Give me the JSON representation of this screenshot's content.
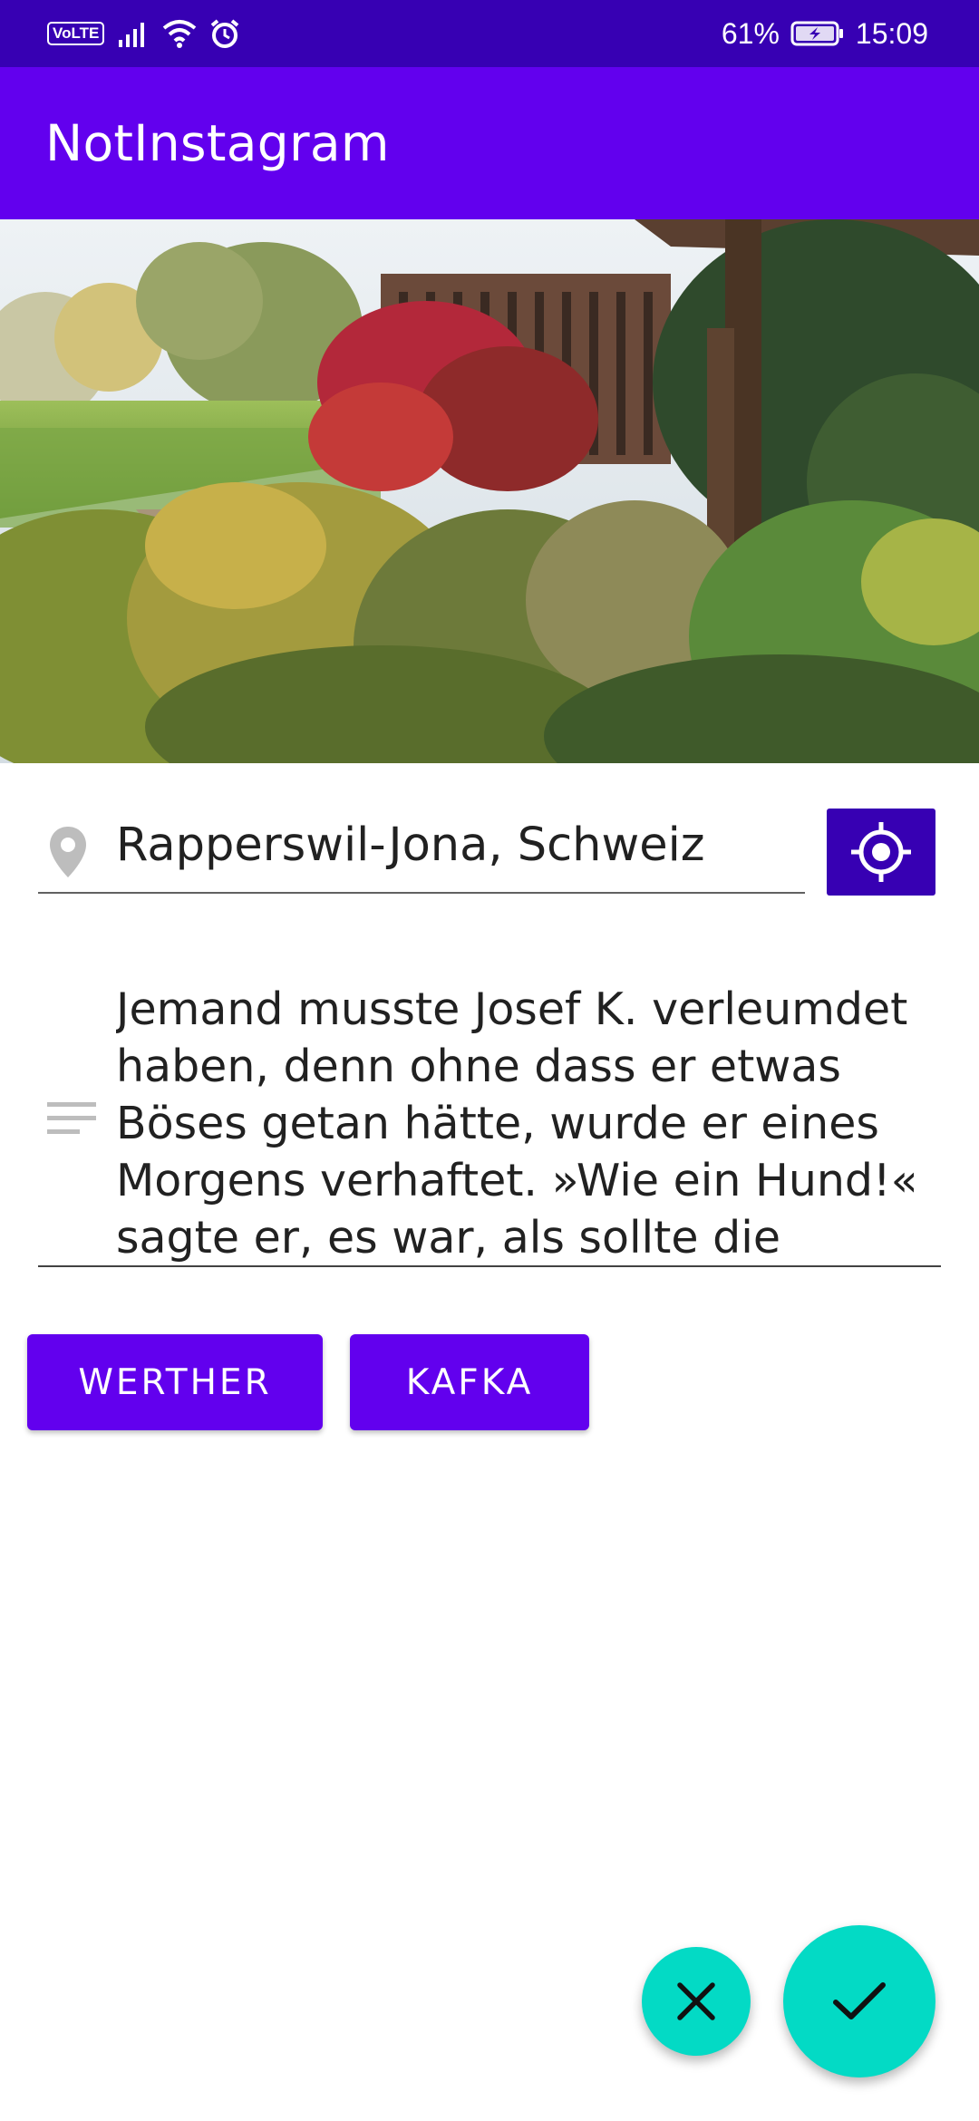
{
  "status_bar": {
    "volte": "VoLTE",
    "battery": "61%",
    "time": "15:09",
    "icons": [
      "volte-icon",
      "signal-icon",
      "wifi-icon",
      "alarm-icon",
      "battery-charging-icon"
    ]
  },
  "app_bar": {
    "title": "NotInstagram",
    "color": "#6200ee",
    "status_color": "#3700b3"
  },
  "photo": {
    "icon": "photo-image"
  },
  "location": {
    "value": "Rapperswil-Jona, Schweiz",
    "icon": "location-pin-icon",
    "locate_button_icon": "gps-fixed-icon"
  },
  "description": {
    "icon": "notes-icon",
    "text": "Jemand musste Josef K. verleumdet haben, denn ohne dass er etwas Böses getan hätte, wurde er eines Morgens verhaftet. »Wie ein Hund!« sagte er, es war, als sollte die Scham"
  },
  "buttons": {
    "werther": "WERTHER",
    "kafka": "KAFKA"
  },
  "fabs": {
    "cancel_icon": "close-icon",
    "confirm_icon": "check-icon",
    "color": "#03dac5"
  }
}
